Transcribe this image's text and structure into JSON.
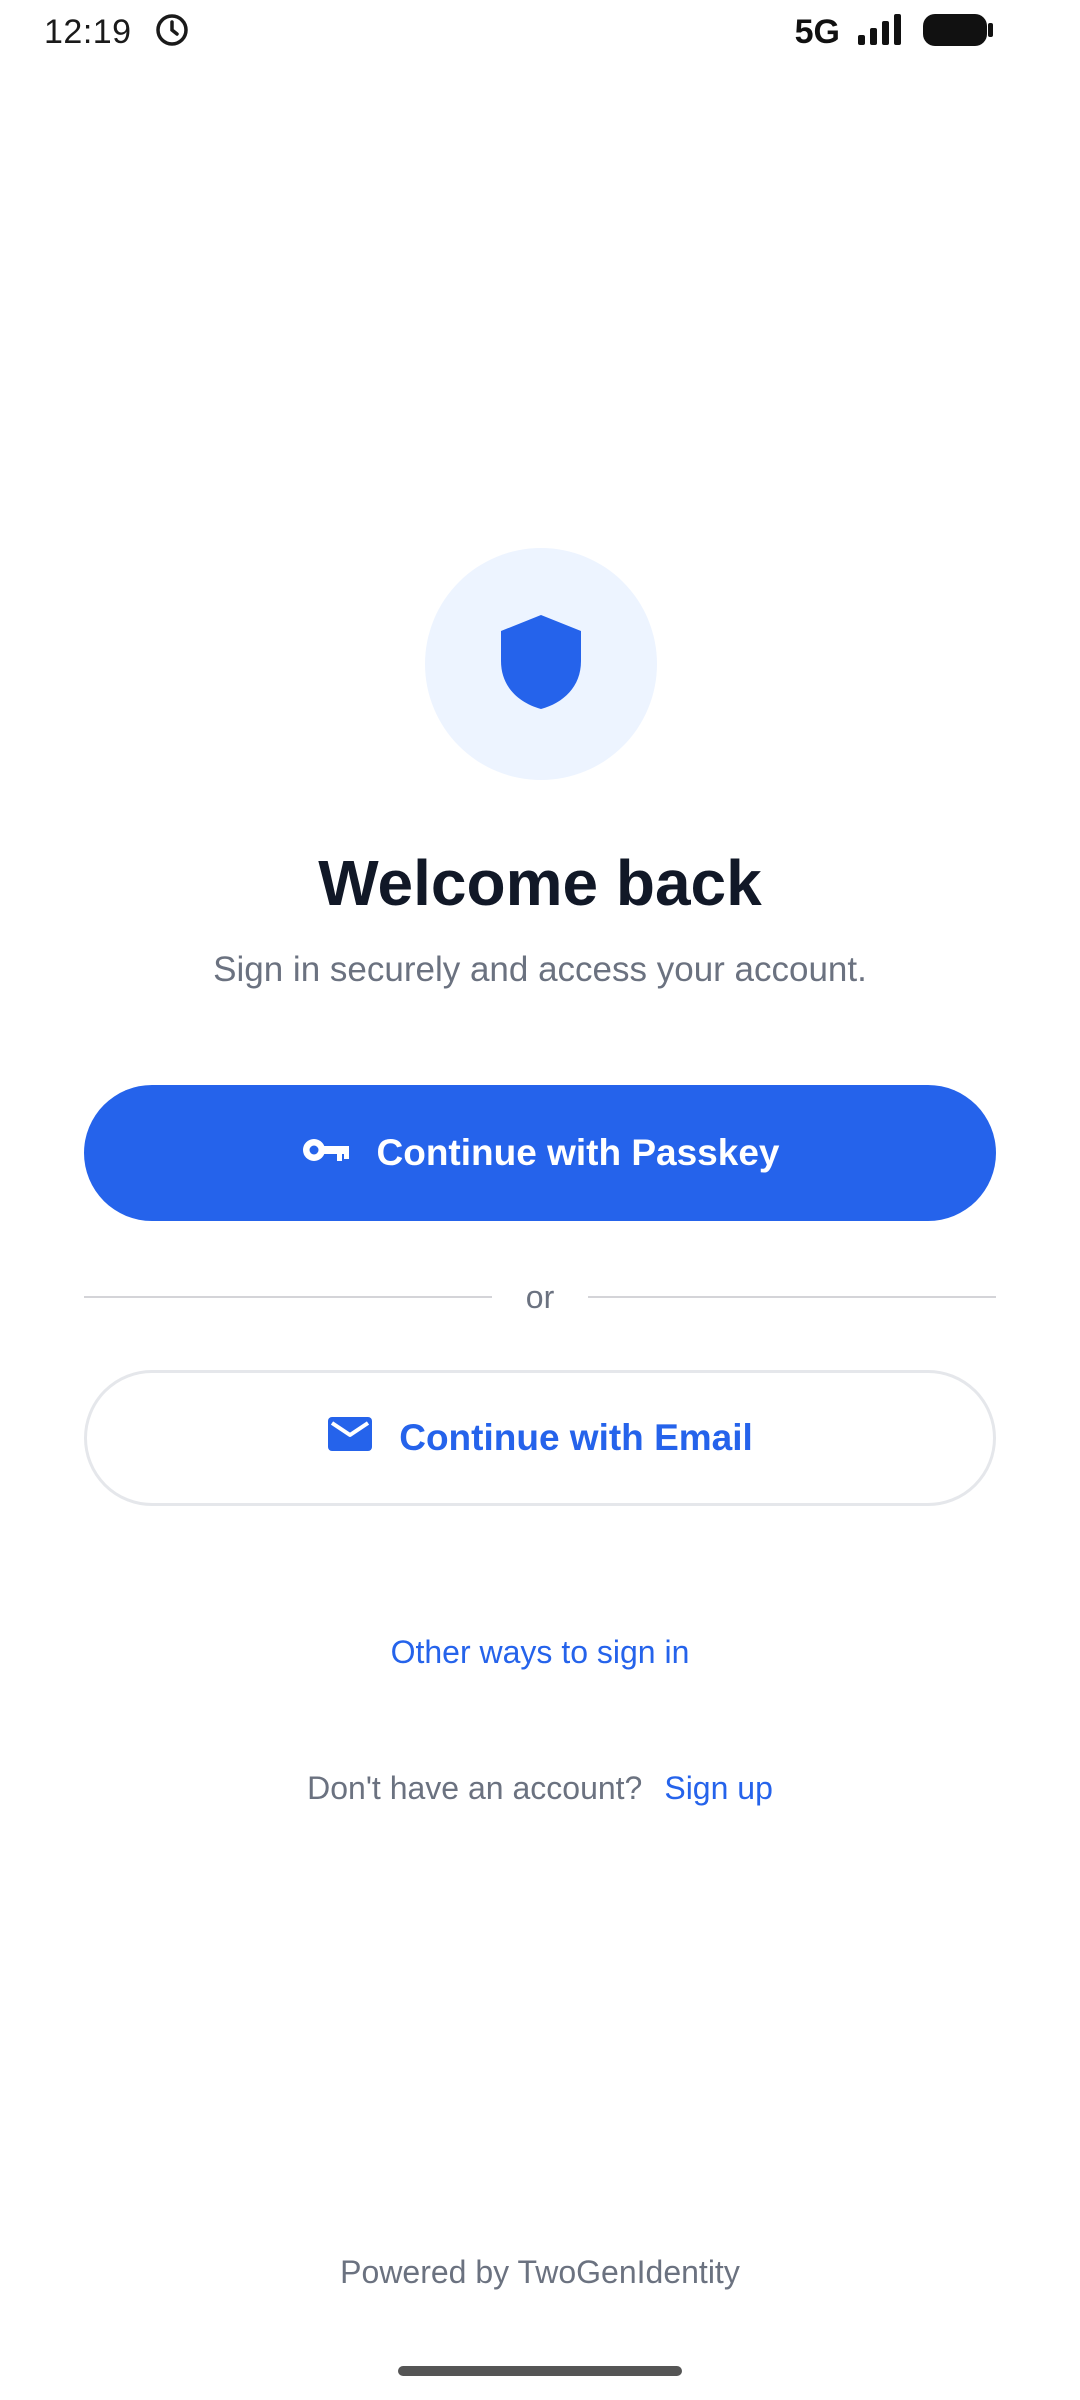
{
  "status_bar": {
    "time": "12:19",
    "network": "5G",
    "icons": [
      "alarm-clock-icon",
      "signal-icon",
      "battery-icon"
    ]
  },
  "hero": {
    "icon": "shield-icon",
    "title": "Welcome back",
    "subtitle": "Sign in securely and access your account."
  },
  "actions": {
    "passkey_label": "Continue with Passkey",
    "passkey_icon": "key-icon",
    "divider_label": "or",
    "email_label": "Continue with Email",
    "email_icon": "mail-icon",
    "other_ways_label": "Other ways to sign in"
  },
  "signup": {
    "prompt": "Don't have an account?",
    "link_label": "Sign up"
  },
  "footer": {
    "powered_by": "Powered by TwoGenIdentity"
  },
  "colors": {
    "accent": "#2563eb",
    "hero_bg": "#edf4ff",
    "title": "#111827",
    "muted": "#6b7280"
  }
}
